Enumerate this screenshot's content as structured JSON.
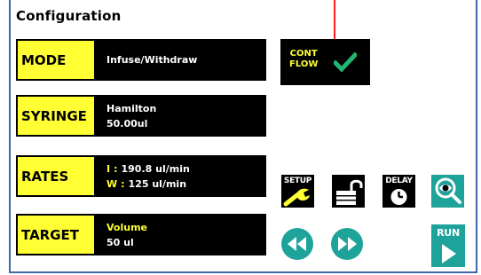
{
  "screen": {
    "title": "Configuration"
  },
  "params": [
    {
      "label": "MODE",
      "lines": [
        "Infuse/Withdraw"
      ]
    },
    {
      "label": "SYRINGE",
      "lines": [
        "Hamilton",
        "50.00ul"
      ]
    },
    {
      "label": "RATES",
      "rates": [
        {
          "prefix": "I",
          "sep": ":",
          "value": "190.8 ul/min"
        },
        {
          "prefix": "W",
          "sep": ":",
          "value": "125 ul/min"
        }
      ]
    },
    {
      "label": "TARGET",
      "lines": [
        "Volume",
        "50 ul"
      ]
    }
  ],
  "cont_flow": {
    "line1": "CONT",
    "line2": "FLOW",
    "checked": true,
    "check_icon": "checkmark-icon"
  },
  "toolbar": {
    "setup_label": "SETUP",
    "delay_label": "DELAY",
    "run_label": "RUN",
    "setup_icon": "wrench-icon",
    "lock_icon": "unlocked-padlock-icon",
    "delay_icon": "clock-icon",
    "view_icon": "magnifier-eye-icon",
    "rewind_icon": "rewind-icon",
    "forward_icon": "fast-forward-icon",
    "run_icon": "play-icon"
  },
  "colors": {
    "label_bg": "#ffff33",
    "button_teal": "#1ea39a",
    "check_green": "#22b573",
    "frame_blue": "#3f66a8",
    "cursor_red": "#ff1a1a"
  }
}
